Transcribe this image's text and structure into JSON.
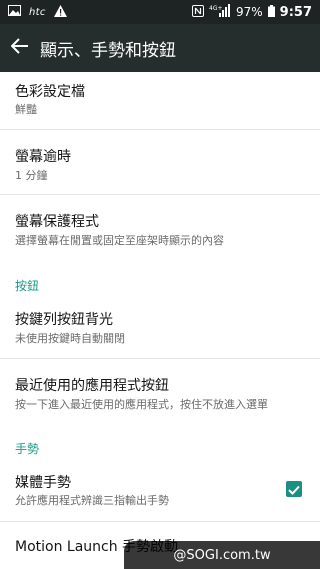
{
  "status_bar": {
    "icons": [
      "image-icon",
      "htc-logo",
      "warning-icon",
      "nfc-icon",
      "signal-4g-icon",
      "battery-icon"
    ],
    "carrier_logo_text": "htc",
    "network_label": "4G+",
    "battery": "97%",
    "time": "9:57"
  },
  "app_bar": {
    "title": "顯示、手勢和按鈕"
  },
  "items": [
    {
      "title": "色彩設定檔",
      "subtitle": "鮮豔"
    },
    {
      "title": "螢幕逾時",
      "subtitle": "1 分鐘"
    },
    {
      "title": "螢幕保護程式",
      "subtitle": "選擇螢幕在閒置或固定至座架時顯示的內容"
    }
  ],
  "sections": {
    "buttons": "按鈕",
    "gestures": "手勢"
  },
  "button_items": [
    {
      "title": "按鍵列按鈕背光",
      "subtitle": "未使用按鍵時自動關閉"
    },
    {
      "title": "最近使用的應用程式按鈕",
      "subtitle": "按一下進入最近使用的應用程式，按住不放進入選單"
    }
  ],
  "gesture_items": [
    {
      "title": "媒體手勢",
      "subtitle": "允許應用程式辨識三指輸出手勢",
      "checked": true
    },
    {
      "title": "Motion Launch 手勢啟動"
    }
  ],
  "watermark": "@SOGI.com.tw",
  "colors": {
    "accent": "#1a9a8a",
    "appbar": "#262d2d",
    "statusbar": "#1e2424"
  }
}
